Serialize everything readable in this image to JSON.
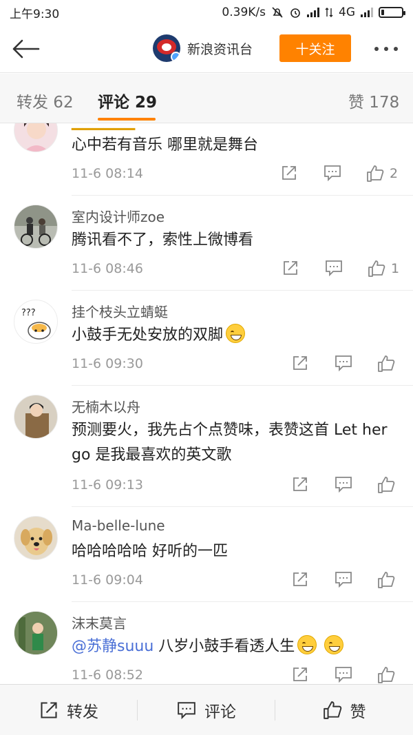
{
  "status_bar": {
    "time": "上午9:30",
    "speed": "0.39K/s",
    "network": "4G"
  },
  "nav": {
    "title": "新浪资讯台",
    "follow_label": "十关注"
  },
  "tabs": [
    {
      "label": "转发 62"
    },
    {
      "label": "评论 29"
    },
    {
      "label": "赞 178"
    }
  ],
  "comments": [
    {
      "username": "",
      "text": "心中若有音乐 哪里就是舞台",
      "time": "11-6 08:14",
      "likes": "2"
    },
    {
      "username": "室内设计师zoe",
      "text": "腾讯看不了，索性上微博看",
      "time": "11-6 08:46",
      "likes": "1"
    },
    {
      "username": "挂个枝头立蜻蜓",
      "text": "小鼓手无处安放的双脚",
      "time": "11-6 09:30",
      "likes": ""
    },
    {
      "username": "无楠木以舟",
      "text": "预测要火，我先占个点赞味，表赞这首 Let her go   是我最喜欢的英文歌",
      "time": "11-6 09:13",
      "likes": ""
    },
    {
      "username": "Ma-belle-lune",
      "text": "哈哈哈哈哈 好听的一匹",
      "time": "11-6 09:04",
      "likes": ""
    },
    {
      "username": "沫末莫言",
      "mention": "@苏静suuu",
      "text": "  八岁小鼓手看透人生",
      "time": "11-6 08:52",
      "likes": ""
    }
  ],
  "bottom_bar": {
    "repost": "转发",
    "comment": "评论",
    "like": "赞"
  },
  "colors": {
    "accent": "#ff8200",
    "mention": "#4a6fd6"
  }
}
